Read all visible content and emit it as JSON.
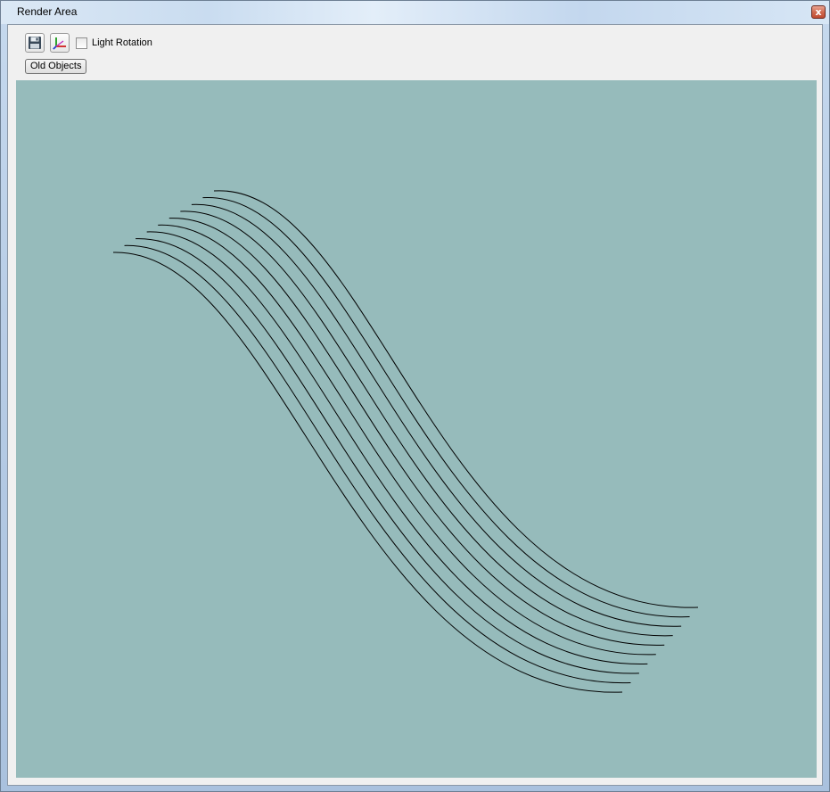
{
  "window": {
    "title": "Render Area",
    "close_glyph": "x"
  },
  "toolbar": {
    "save_icon": "floppy-disk-icon",
    "axes_icon": "xyz-axes-icon",
    "light_rotation_label": "Light Rotation",
    "light_rotation_checked": false,
    "old_objects_label": "Old Objects"
  },
  "viewport": {
    "background": "#96bbbb",
    "curve_color": "#000000",
    "curve_count": 10
  }
}
